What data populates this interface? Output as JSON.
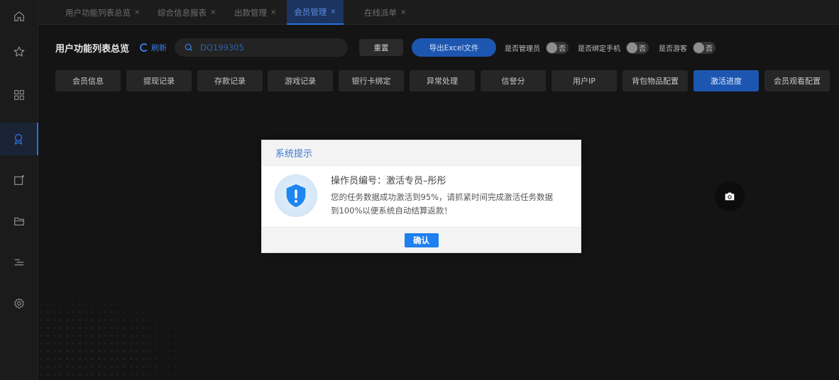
{
  "sidebar": {
    "icons": [
      "home-icon",
      "star-icon",
      "grid-icon",
      "member-icon",
      "box-icon",
      "folder-icon",
      "list-icon",
      "gear-icon"
    ],
    "active_index": 3
  },
  "tabs": [
    {
      "label": "用户功能列表总览",
      "close": "×"
    },
    {
      "label": "综合信息报表",
      "close": "×"
    },
    {
      "label": "出款管理",
      "close": "×"
    },
    {
      "label": "会员管理",
      "close": "×",
      "active": true
    },
    {
      "label": "在线派单",
      "close": "×"
    }
  ],
  "toolbar": {
    "title": "用户功能列表总览",
    "refresh_label": "刷新",
    "search_value": "DQ199305",
    "reset_label": "重置",
    "export_label": "导出Excel文件",
    "toggles": [
      {
        "label": "是否管理员",
        "value": "否"
      },
      {
        "label": "是否绑定手机",
        "value": "否"
      },
      {
        "label": "是否游客",
        "value": "否"
      }
    ]
  },
  "subtabs": [
    "会员信息",
    "提现记录",
    "存款记录",
    "游戏记录",
    "银行卡绑定",
    "异常处理",
    "信誉分",
    "用户IP",
    "背包物品配置",
    "激活进度",
    "会员观看配置"
  ],
  "subtab_active_index": 9,
  "modal": {
    "header": "系统提示",
    "title": "操作员编号：激活专员–彤彤",
    "message_line1": "您的任务数据成功激活到95%，请抓紧时间完成激活任务数据",
    "message_line2": "到100%以便系统自动结算返款！",
    "confirm_label": "确认"
  },
  "colors": {
    "accent": "#1d56b0",
    "link_blue": "#3a7be0",
    "confirm_blue": "#1e7ff0",
    "background": "#141414"
  }
}
